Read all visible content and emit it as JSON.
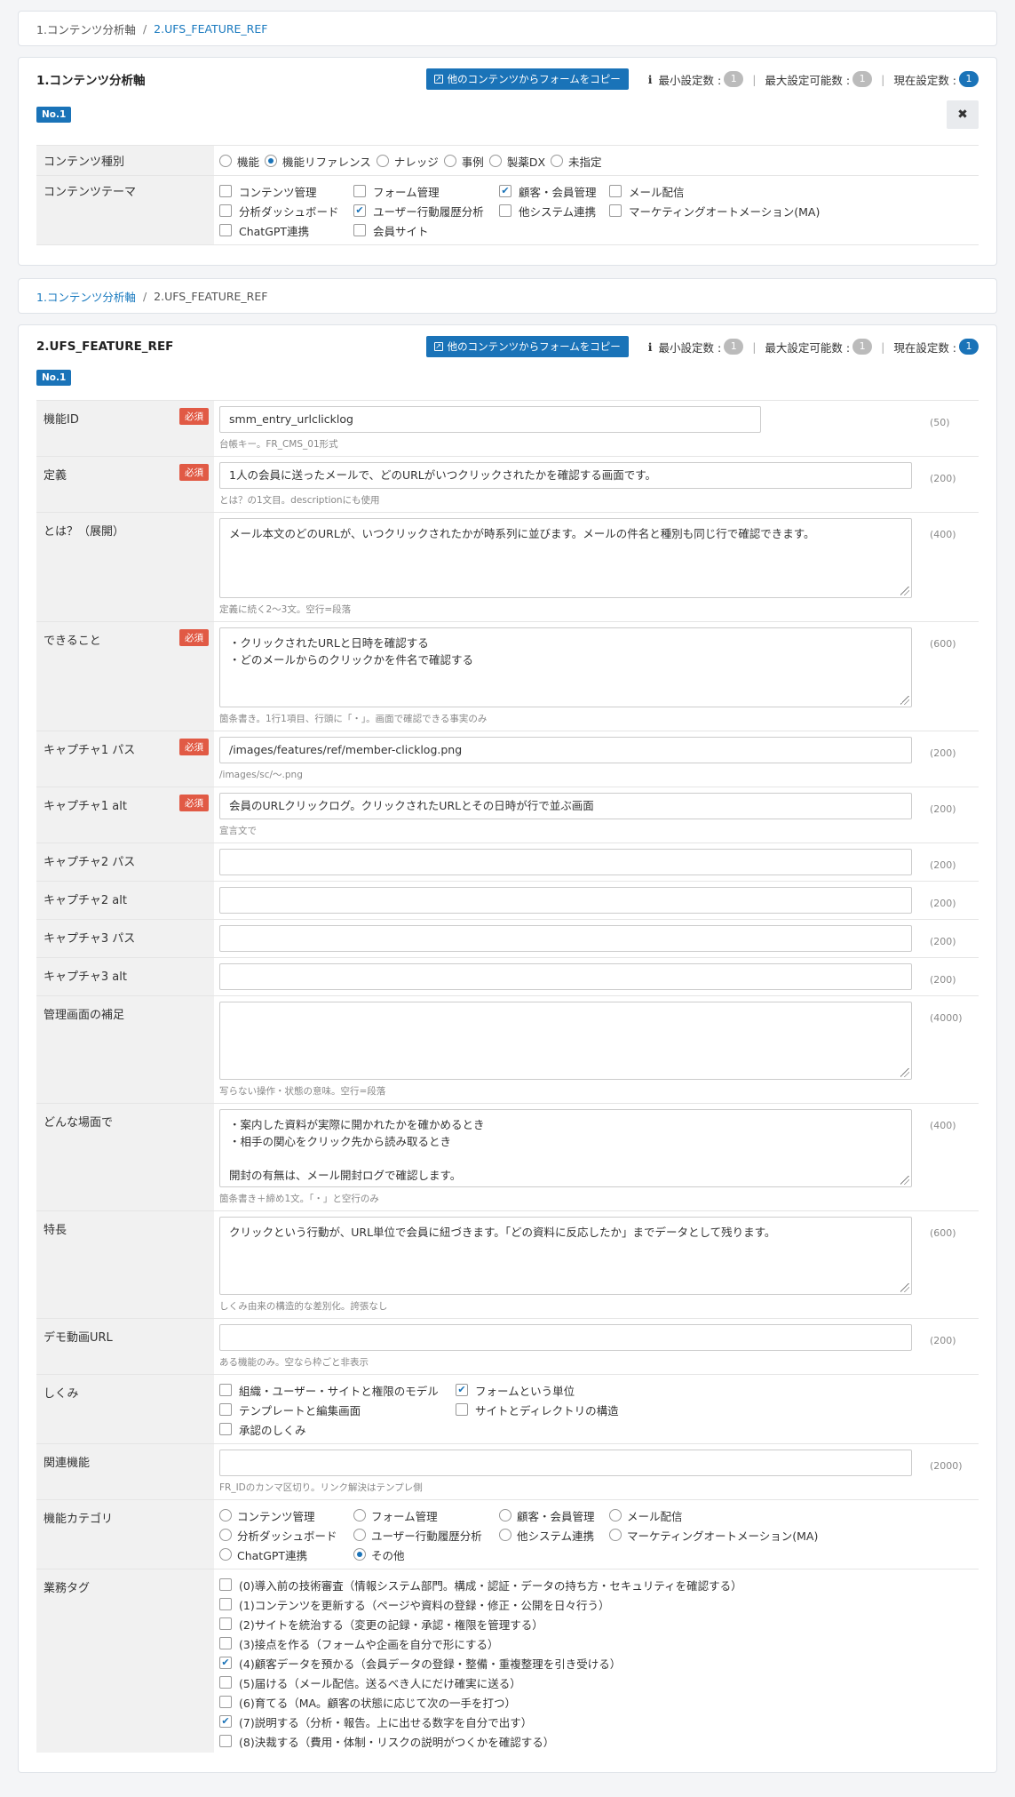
{
  "top_breadcrumb": {
    "item1": "1.コンテンツ分析軸",
    "sep": "/",
    "item2": "2.UFS_FEATURE_REF"
  },
  "tools": {
    "copy_label": "他のコンテンツからフォームをコピー",
    "info_icon": "i",
    "min_label": "最小設定数 :",
    "max_label": "最大設定可能数 :",
    "cur_label": "現在設定数 :"
  },
  "panel1": {
    "title": "1.コンテンツ分析軸",
    "min_count": "1",
    "max_count": "1",
    "cur_count": "1",
    "no_badge": "No.1",
    "close_icon": "✖",
    "type_label": "コンテンツ種別",
    "type_options": [
      {
        "label": "機能",
        "checked": false
      },
      {
        "label": "機能リファレンス",
        "checked": true
      },
      {
        "label": "ナレッジ",
        "checked": false
      },
      {
        "label": "事例",
        "checked": false
      },
      {
        "label": "製薬DX",
        "checked": false
      },
      {
        "label": "未指定",
        "checked": false
      }
    ],
    "theme_label": "コンテンツテーマ",
    "theme_options": [
      {
        "label": "コンテンツ管理",
        "checked": false
      },
      {
        "label": "フォーム管理",
        "checked": false
      },
      {
        "label": "顧客・会員管理",
        "checked": true
      },
      {
        "label": "メール配信",
        "checked": false
      },
      {
        "label": "分析ダッシュボード",
        "checked": false
      },
      {
        "label": "ユーザー行動履歴分析",
        "checked": true
      },
      {
        "label": "他システム連携",
        "checked": false
      },
      {
        "label": "マーケティングオートメーション(MA)",
        "checked": false
      },
      {
        "label": "ChatGPT連携",
        "checked": false
      },
      {
        "label": "会員サイト",
        "checked": false
      }
    ]
  },
  "mid_breadcrumb": {
    "item1": "1.コンテンツ分析軸",
    "sep": "/",
    "item2": "2.UFS_FEATURE_REF"
  },
  "panel2": {
    "title": "2.UFS_FEATURE_REF",
    "min_count": "1",
    "max_count": "1",
    "cur_count": "1",
    "no_badge": "No.1",
    "required_badge": "必須",
    "fields": {
      "feature_id": {
        "label": "機能ID",
        "value": "smm_entry_urlclicklog",
        "hint": "台帳キー。FR_CMS_01形式",
        "limit": "(50)"
      },
      "definition": {
        "label": "定義",
        "value": "1人の会員に送ったメールで、どのURLがいつクリックされたかを確認する画面です。",
        "hint": "とは？の1文目。descriptionにも使用",
        "limit": "(200)"
      },
      "whatis": {
        "label": "とは？（展開）",
        "value": "メール本文のどのURLが、いつクリックされたかが時系列に並びます。メールの件名と種別も同じ行で確認できます。",
        "hint": "定義に続く2〜3文。空行=段落",
        "limit": "(400)"
      },
      "can_do": {
        "label": "できること",
        "value": "・クリックされたURLと日時を確認する\n・どのメールからのクリックかを件名で確認する",
        "hint": "箇条書き。1行1項目、行頭に「・」。画面で確認できる事実のみ",
        "limit": "(600)"
      },
      "cap1_path": {
        "label": "キャプチャ1 パス",
        "value": "/images/features/ref/member-clicklog.png",
        "hint": "/images/sc/〜.png",
        "limit": "(200)"
      },
      "cap1_alt": {
        "label": "キャプチャ1 alt",
        "value": "会員のURLクリックログ。クリックされたURLとその日時が行で並ぶ画面",
        "hint": "宣言文で",
        "limit": "(200)"
      },
      "cap2_path": {
        "label": "キャプチャ2 パス",
        "value": "",
        "limit": "(200)"
      },
      "cap2_alt": {
        "label": "キャプチャ2 alt",
        "value": "",
        "limit": "(200)"
      },
      "cap3_path": {
        "label": "キャプチャ3 パス",
        "value": "",
        "limit": "(200)"
      },
      "cap3_alt": {
        "label": "キャプチャ3 alt",
        "value": "",
        "limit": "(200)"
      },
      "admin_note": {
        "label": "管理画面の補足",
        "value": "",
        "hint": "写らない操作・状態の意味。空行=段落",
        "limit": "(4000)"
      },
      "scene": {
        "label": "どんな場面で",
        "value": "・案内した資料が実際に開かれたかを確かめるとき\n・相手の関心をクリック先から読み取るとき\n\n開封の有無は、メール開封ログで確認します。",
        "hint": "箇条書き＋締め1文。「・」と空行のみ",
        "limit": "(400)"
      },
      "feature": {
        "label": "特長",
        "value": "クリックという行動が、URL単位で会員に紐づきます。「どの資料に反応したか」までデータとして残ります。",
        "hint": "しくみ由来の構造的な差別化。誇張なし",
        "limit": "(600)"
      },
      "demo_url": {
        "label": "デモ動画URL",
        "value": "",
        "hint": "ある機能のみ。空なら枠ごと非表示",
        "limit": "(200)"
      },
      "mechanism": {
        "label": "しくみ"
      },
      "related": {
        "label": "関連機能",
        "value": "",
        "hint": "FR_IDのカンマ区切り。リンク解決はテンプレ側",
        "limit": "(2000)"
      },
      "category": {
        "label": "機能カテゴリ"
      },
      "tags": {
        "label": "業務タグ"
      }
    },
    "mechanism_options": [
      {
        "label": "組織・ユーザー・サイトと権限のモデル",
        "checked": false
      },
      {
        "label": "フォームという単位",
        "checked": true
      },
      {
        "label": "テンプレートと編集画面",
        "checked": false
      },
      {
        "label": "サイトとディレクトリの構造",
        "checked": false
      },
      {
        "label": "承認のしくみ",
        "checked": false
      }
    ],
    "category_options": [
      {
        "label": "コンテンツ管理",
        "checked": false
      },
      {
        "label": "フォーム管理",
        "checked": false
      },
      {
        "label": "顧客・会員管理",
        "checked": false
      },
      {
        "label": "メール配信",
        "checked": false
      },
      {
        "label": "分析ダッシュボード",
        "checked": false
      },
      {
        "label": "ユーザー行動履歴分析",
        "checked": false
      },
      {
        "label": "他システム連携",
        "checked": false
      },
      {
        "label": "マーケティングオートメーション(MA)",
        "checked": false
      },
      {
        "label": "ChatGPT連携",
        "checked": false
      },
      {
        "label": "その他",
        "checked": true
      }
    ],
    "tag_options": [
      {
        "label": "(0)導入前の技術審査（情報システム部門。構成・認証・データの持ち方・セキュリティを確認する）",
        "checked": false
      },
      {
        "label": "(1)コンテンツを更新する（ページや資料の登録・修正・公開を日々行う）",
        "checked": false
      },
      {
        "label": "(2)サイトを統治する（変更の記録・承認・権限を管理する）",
        "checked": false
      },
      {
        "label": "(3)接点を作る（フォームや企画を自分で形にする）",
        "checked": false
      },
      {
        "label": "(4)顧客データを預かる（会員データの登録・整備・重複整理を引き受ける）",
        "checked": true
      },
      {
        "label": "(5)届ける（メール配信。送るべき人にだけ確実に送る）",
        "checked": false
      },
      {
        "label": "(6)育てる（MA。顧客の状態に応じて次の一手を打つ）",
        "checked": false
      },
      {
        "label": "(7)説明する（分析・報告。上に出せる数字を自分で出す）",
        "checked": true
      },
      {
        "label": "(8)決裁する（費用・体制・リスクの説明がつくかを確認する）",
        "checked": false
      }
    ]
  }
}
